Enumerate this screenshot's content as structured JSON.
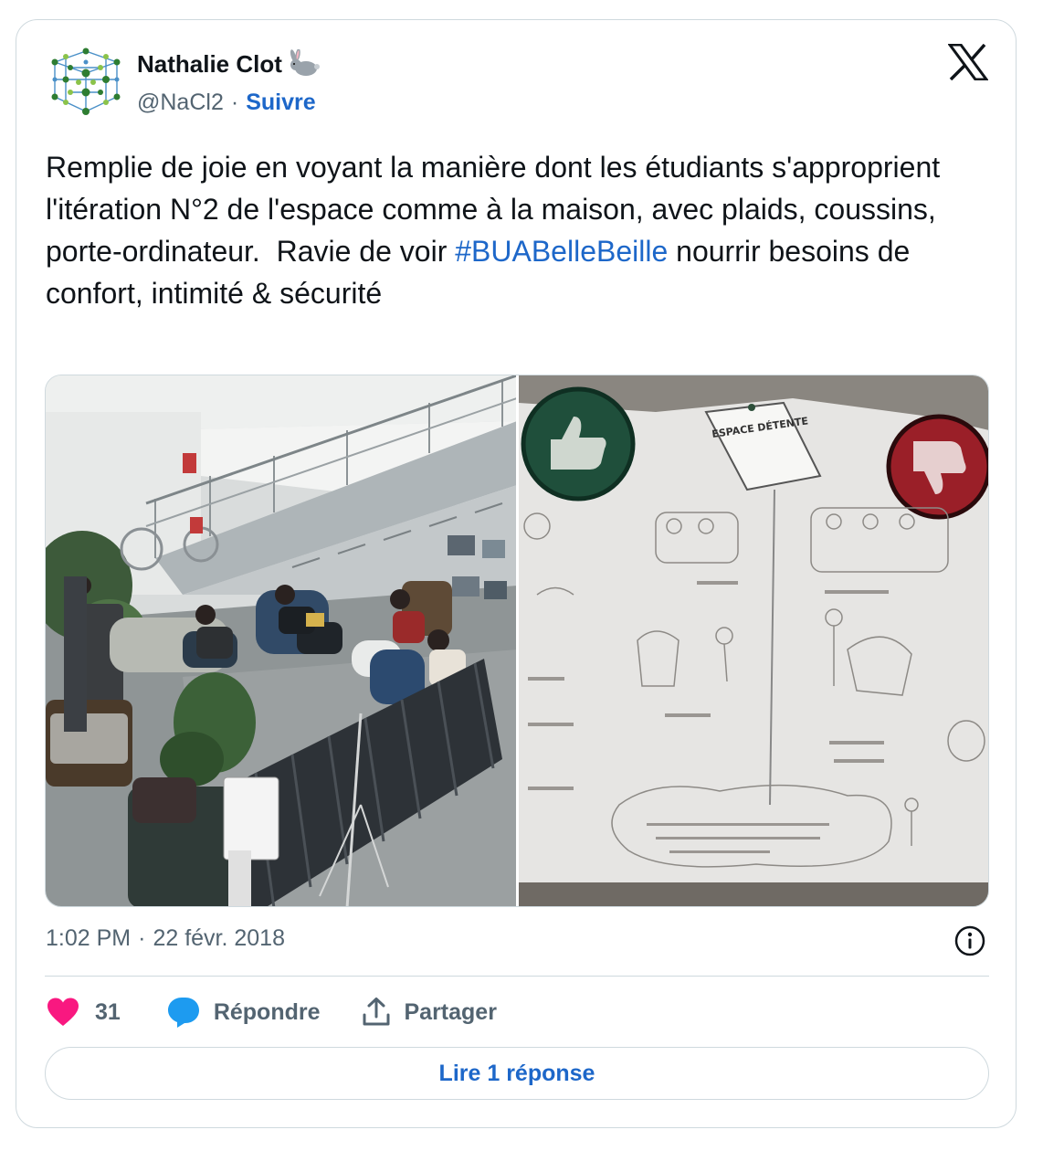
{
  "author": {
    "name": "Nathalie Clot",
    "handle": "@NaCl2",
    "separator": "·",
    "follow_label": "Suivre"
  },
  "tweet": {
    "text_before": "Remplie de joie en voyant la manière dont les étudiants s'approprient l'itération N°2 de l'espace comme à la maison, avec plaids, coussins, porte-ordinateur.  Ravie de voir ",
    "hashtag": "#BUABelleBeille",
    "text_after": " nourrir besoins de confort, intimité & sécurité"
  },
  "media": {
    "photo1_icon": "library-lounge-photo",
    "photo2_icon": "espace-detente-poster-photo",
    "poster_title": "ESPACE DÉTENTE"
  },
  "meta": {
    "time": "1:02 PM",
    "separator": "·",
    "date": "22 févr. 2018"
  },
  "actions": {
    "like_count": "31",
    "reply_label": "Répondre",
    "share_label": "Partager"
  },
  "read_replies_label": "Lire 1 réponse",
  "colors": {
    "accent": "#1d67c9",
    "like": "#f91880",
    "reply_icon": "#1d9bf0",
    "muted": "#536471",
    "border": "#cfd9de"
  }
}
